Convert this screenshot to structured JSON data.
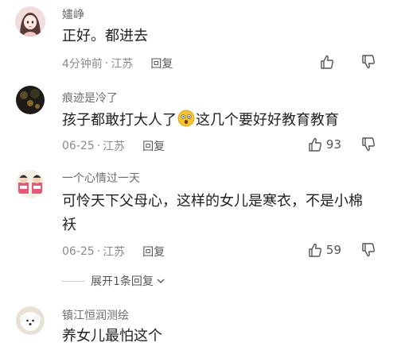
{
  "comments": [
    {
      "username": "嫿峥",
      "text": "正好。都进去",
      "time": "4分钟前",
      "location": "江苏",
      "reply_label": "回复",
      "likes": ""
    },
    {
      "username": "痕迹是冷了",
      "text_before": "孩子都敢打大人了",
      "text_after": "这几个要好好教育教育",
      "emoji": "shocked-face",
      "time": "06-25",
      "location": "江苏",
      "reply_label": "回复",
      "likes": "93"
    },
    {
      "username": "一个心情过一天",
      "text_line1": "可怜天下父母心，这样的女儿是寒衣，不是小棉",
      "text_line2": "袄",
      "time": "06-25",
      "location": "江苏",
      "reply_label": "回复",
      "likes": "59",
      "expand_label": "展开1条回复"
    },
    {
      "username": "镇江恒润测绘",
      "text": "养女儿最怕这个"
    }
  ],
  "separator": "·",
  "colors": {
    "text": "#1f1f1f",
    "meta": "#8a8a8a",
    "username": "#6d6d6d"
  }
}
